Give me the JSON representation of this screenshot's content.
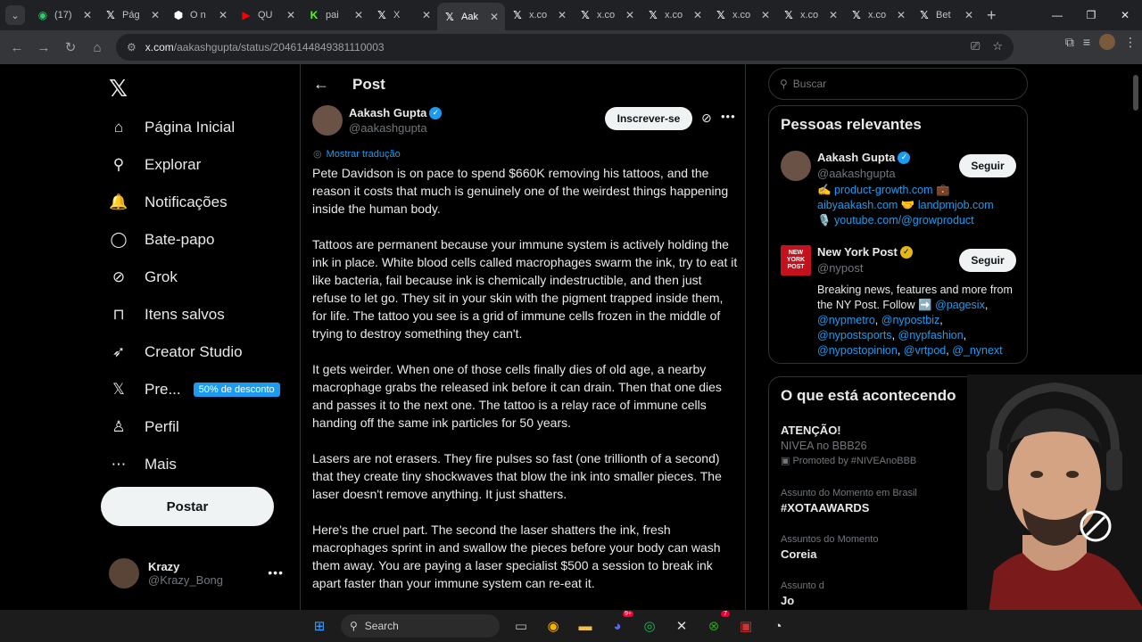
{
  "browser": {
    "tabs": [
      {
        "label": "(17)",
        "icon": "whatsapp-icon",
        "color": "#25d366",
        "glyph": "◉"
      },
      {
        "label": "Pág",
        "icon": "x-logo-icon",
        "color": "#ffffff",
        "glyph": "𝕏"
      },
      {
        "label": "O n",
        "icon": "github-icon",
        "color": "#ffffff",
        "glyph": "⬢"
      },
      {
        "label": "QU",
        "icon": "youtube-icon",
        "color": "#ff0000",
        "glyph": "▶"
      },
      {
        "label": "pai",
        "icon": "kick-icon",
        "color": "#53fc18",
        "glyph": "K"
      },
      {
        "label": "X",
        "icon": "x-logo-icon",
        "color": "#ffffff",
        "glyph": "𝕏"
      },
      {
        "label": "Aak",
        "icon": "x-logo-icon",
        "color": "#ffffff",
        "glyph": "𝕏",
        "active": true
      },
      {
        "label": "x.co",
        "icon": "x-logo-icon",
        "color": "#ffffff",
        "glyph": "𝕏"
      },
      {
        "label": "x.co",
        "icon": "x-logo-icon",
        "color": "#ffffff",
        "glyph": "𝕏"
      },
      {
        "label": "x.co",
        "icon": "x-logo-icon",
        "color": "#ffffff",
        "glyph": "𝕏"
      },
      {
        "label": "x.co",
        "icon": "x-logo-icon",
        "color": "#ffffff",
        "glyph": "𝕏"
      },
      {
        "label": "x.co",
        "icon": "x-logo-icon",
        "color": "#ffffff",
        "glyph": "𝕏"
      },
      {
        "label": "x.co",
        "icon": "x-logo-icon",
        "color": "#ffffff",
        "glyph": "𝕏"
      },
      {
        "label": "Bet",
        "icon": "x-logo-icon",
        "color": "#ffffff",
        "glyph": "𝕏"
      }
    ],
    "url_host": "x.com",
    "url_path": "/aakashgupta/status/2046144849381110003"
  },
  "nav": {
    "items": [
      {
        "label": "Página Inicial",
        "icon": "home-icon",
        "glyph": "⌂"
      },
      {
        "label": "Explorar",
        "icon": "search-icon",
        "glyph": "⚲"
      },
      {
        "label": "Notificações",
        "icon": "bell-icon",
        "glyph": "🔔"
      },
      {
        "label": "Bate-papo",
        "icon": "chat-icon",
        "glyph": "◯"
      },
      {
        "label": "Grok",
        "icon": "grok-icon",
        "glyph": "⊘"
      },
      {
        "label": "Itens salvos",
        "icon": "bookmark-icon",
        "glyph": "⊓"
      },
      {
        "label": "Creator Studio",
        "icon": "rocket-icon",
        "glyph": "➶"
      },
      {
        "label": "Pre...",
        "icon": "x-premium-icon",
        "glyph": "𝕏"
      },
      {
        "label": "Perfil",
        "icon": "person-icon",
        "glyph": "♙"
      },
      {
        "label": "Mais",
        "icon": "more-circle-icon",
        "glyph": "⋯"
      }
    ],
    "premium_badge": "50% de desconto",
    "post_button": "Postar"
  },
  "account": {
    "name": "Krazy",
    "handle": "@Krazy_Bong"
  },
  "post": {
    "header_title": "Post",
    "author_name": "Aakash Gupta",
    "author_handle": "@aakashgupta",
    "subscribe": "Inscrever-se",
    "translate": "Mostrar tradução",
    "paragraphs": [
      "Pete Davidson is on pace to spend $660K removing his tattoos, and the reason it costs that much is genuinely one of the weirdest things happening inside the human body.",
      "Tattoos are permanent because your immune system is actively holding the ink in place. White blood cells called macrophages swarm the ink, try to eat it like bacteria, fail because ink is chemically indestructible, and then just refuse to let go. They sit in your skin with the pigment trapped inside them, for life. The tattoo you see is a grid of immune cells frozen in the middle of trying to destroy something they can't.",
      "It gets weirder. When one of those cells finally dies of old age, a nearby macrophage grabs the released ink before it can drain. Then that one dies and passes it to the next one. The tattoo is a relay race of immune cells handing off the same ink particles for 50 years.",
      "Lasers are not erasers. They fire pulses so fast (one trillionth of a second) that they create tiny shockwaves that blow the ink into smaller pieces. The laser doesn't remove anything. It just shatters.",
      "Here's the cruel part. The second the laser shatters the ink, fresh macrophages sprint in and swallow the pieces before your body can wash them away. You are paying a laser specialist $500 a session to break ink apart faster than your immune system can re-eat it."
    ]
  },
  "sidebar": {
    "search_placeholder": "Buscar",
    "relevant_title": "Pessoas relevantes",
    "people": [
      {
        "name": "Aakash Gupta",
        "handle": "@aakashgupta",
        "follow": "Seguir",
        "bio_lines": [
          {
            "pre": "✍️ ",
            "link": "product-growth.com",
            "post": " 💼"
          },
          {
            "pre": "",
            "link": "aibyaakash.com",
            "post": " 🤝 ",
            "link2": "landpmjob.com"
          },
          {
            "pre": "🎙️ ",
            "link": "youtube.com/@growproduct",
            "post": ""
          }
        ]
      },
      {
        "name": "New York Post",
        "handle": "@nypost",
        "follow": "Seguir",
        "logo_text": "NEW YORK POST",
        "bio_text": "Breaking news, features and more from the NY Post. Follow ➡️ ",
        "bio_links": [
          "@pagesix",
          "@nypmetro",
          "@nypostbiz",
          "@nypostsports",
          "@nypfashion",
          "@nypostopinion",
          "@vrtpod",
          "@_nynext"
        ]
      }
    ],
    "happening_title": "O que está acontecendo",
    "trends": [
      {
        "title": "ATENÇÃO!",
        "sub": "NIVEA no BBB26",
        "promo": "Promoted by #NIVEAnoBBB"
      },
      {
        "context": "Assunto do Momento em Brasil",
        "title": "#XOTAAWARDS"
      },
      {
        "context": "Assuntos do Momento",
        "title": "Coreia"
      },
      {
        "context": "Assunto d",
        "title": "Jo"
      }
    ]
  },
  "taskbar": {
    "search": "Search",
    "discord_badge": "9+",
    "xbox_badge": "7"
  },
  "colors": {
    "accent": "#1d9bf0",
    "background": "#000000",
    "border": "#2f3336",
    "muted": "#71767b"
  }
}
